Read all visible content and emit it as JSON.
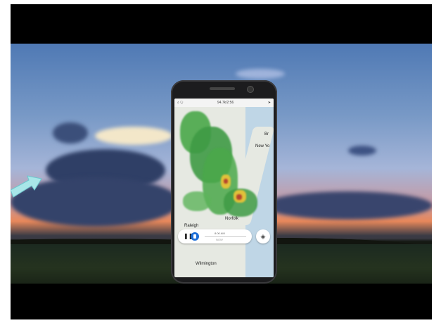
{
  "phone": {
    "status_center": "94.7k/2:56",
    "labels": {
      "new_york": "New Yo",
      "br": "Br",
      "norfolk": "Norfolk",
      "raleigh": "Raleigh",
      "wilmington": "Wilmington",
      "playback_top": "8:00 AM",
      "playback_bottom": "NOW"
    }
  },
  "icons": {
    "search": "search-icon",
    "refresh": "refresh-icon",
    "location": "location-arrow-icon",
    "pause": "pause-icon",
    "play": "play-icon",
    "layers": "layers-icon",
    "arrow": "pointer-arrow-icon"
  },
  "colors": {
    "radar_green": "#4aa84a",
    "radar_dark": "#2f7f3a",
    "storm_yellow": "#e0c13a",
    "storm_red": "#b5442d",
    "play_blue": "#1e6fd8"
  }
}
